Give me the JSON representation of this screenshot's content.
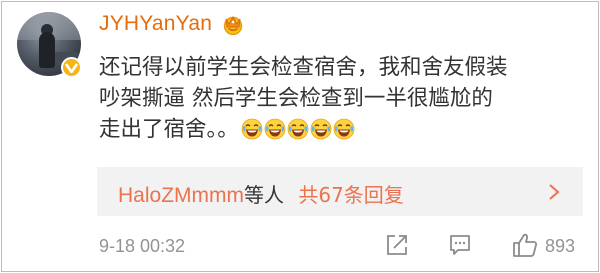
{
  "post": {
    "username": "JYHYanYan",
    "comment_lines": [
      "还记得以前学生会检查宿舍，我和舍友假装",
      "吵架撕逼 然后学生会检查到一半很尴尬的",
      "走出了宿舍。。"
    ],
    "emoji_name": "laughing-crying-face-emoji",
    "emoji_count": 5,
    "replies": {
      "first_user": "HaloZMmmm",
      "others_text": "等人",
      "count_text": "共67条回复"
    },
    "timestamp": "9-18 00:32",
    "like_count": "893"
  },
  "colors": {
    "username": "#e86b0b",
    "reply_link": "#eb7350",
    "text": "#333333",
    "meta": "#939393",
    "reply_bg": "#f2f2f2",
    "verified_badge": "#f5b417"
  },
  "icons": {
    "verified": "verified-badge-icon",
    "vip": "crown-icon",
    "share": "share-icon",
    "comment": "comment-icon",
    "like": "thumbs-up-icon",
    "expand": "chevron-right-icon"
  }
}
